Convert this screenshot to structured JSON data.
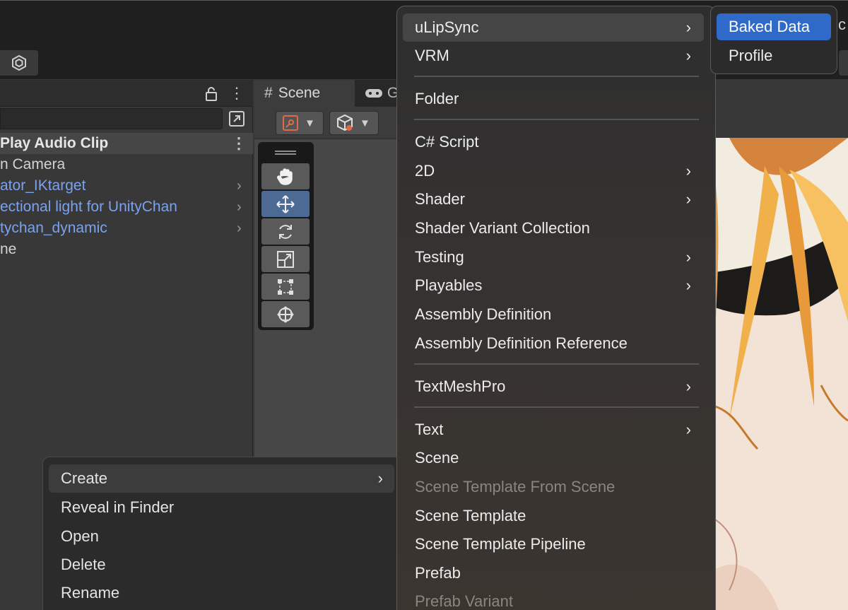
{
  "hierarchy": {
    "rows": [
      {
        "label": "Play Audio Clip",
        "kind": "scene"
      },
      {
        "label": "n Camera",
        "kind": "object"
      },
      {
        "label": "ator_IKtarget",
        "kind": "prefab"
      },
      {
        "label": "ectional light for UnityChan",
        "kind": "prefab"
      },
      {
        "label": "tychan_dynamic",
        "kind": "prefab"
      },
      {
        "label": "ne",
        "kind": "object"
      }
    ]
  },
  "scene_view": {
    "tab_label": "Scene",
    "game_tab_label": "G"
  },
  "context_menu": {
    "items": [
      "Create",
      "Reveal in Finder",
      "Open",
      "Delete",
      "Rename"
    ]
  },
  "create_menu": {
    "items": [
      "uLipSync",
      "VRM",
      "Folder",
      "C# Script",
      "2D",
      "Shader",
      "Shader Variant Collection",
      "Testing",
      "Playables",
      "Assembly Definition",
      "Assembly Definition Reference",
      "TextMeshPro",
      "Text",
      "Scene",
      "Scene Template From Scene",
      "Scene Template",
      "Scene Template Pipeline",
      "Prefab",
      "Prefab Variant"
    ]
  },
  "ulipsync_menu": {
    "items": [
      "Baked Data",
      "Profile"
    ]
  },
  "edge_text": "c",
  "colors": {
    "selection": "#2f6ac9",
    "prefab_text": "#7ba2eb",
    "active_tool": "#4c6a93"
  }
}
